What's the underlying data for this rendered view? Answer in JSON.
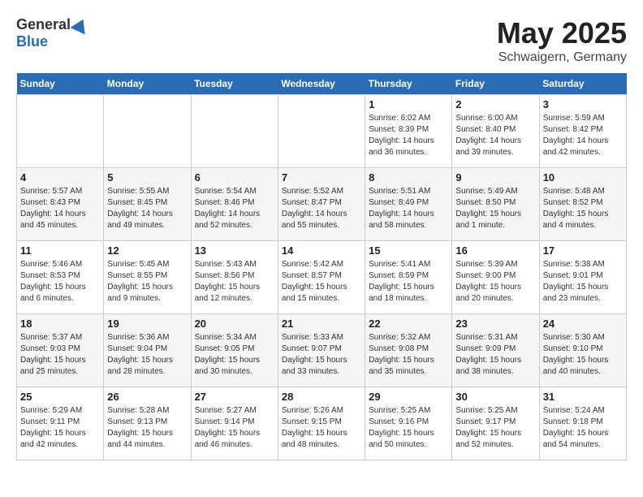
{
  "header": {
    "logo_general": "General",
    "logo_blue": "Blue",
    "title": "May 2025",
    "location": "Schwaigern, Germany"
  },
  "weekdays": [
    "Sunday",
    "Monday",
    "Tuesday",
    "Wednesday",
    "Thursday",
    "Friday",
    "Saturday"
  ],
  "weeks": [
    [
      {
        "day": "",
        "info": ""
      },
      {
        "day": "",
        "info": ""
      },
      {
        "day": "",
        "info": ""
      },
      {
        "day": "",
        "info": ""
      },
      {
        "day": "1",
        "info": "Sunrise: 6:02 AM\nSunset: 8:39 PM\nDaylight: 14 hours\nand 36 minutes."
      },
      {
        "day": "2",
        "info": "Sunrise: 6:00 AM\nSunset: 8:40 PM\nDaylight: 14 hours\nand 39 minutes."
      },
      {
        "day": "3",
        "info": "Sunrise: 5:59 AM\nSunset: 8:42 PM\nDaylight: 14 hours\nand 42 minutes."
      }
    ],
    [
      {
        "day": "4",
        "info": "Sunrise: 5:57 AM\nSunset: 8:43 PM\nDaylight: 14 hours\nand 45 minutes."
      },
      {
        "day": "5",
        "info": "Sunrise: 5:55 AM\nSunset: 8:45 PM\nDaylight: 14 hours\nand 49 minutes."
      },
      {
        "day": "6",
        "info": "Sunrise: 5:54 AM\nSunset: 8:46 PM\nDaylight: 14 hours\nand 52 minutes."
      },
      {
        "day": "7",
        "info": "Sunrise: 5:52 AM\nSunset: 8:47 PM\nDaylight: 14 hours\nand 55 minutes."
      },
      {
        "day": "8",
        "info": "Sunrise: 5:51 AM\nSunset: 8:49 PM\nDaylight: 14 hours\nand 58 minutes."
      },
      {
        "day": "9",
        "info": "Sunrise: 5:49 AM\nSunset: 8:50 PM\nDaylight: 15 hours\nand 1 minute."
      },
      {
        "day": "10",
        "info": "Sunrise: 5:48 AM\nSunset: 8:52 PM\nDaylight: 15 hours\nand 4 minutes."
      }
    ],
    [
      {
        "day": "11",
        "info": "Sunrise: 5:46 AM\nSunset: 8:53 PM\nDaylight: 15 hours\nand 6 minutes."
      },
      {
        "day": "12",
        "info": "Sunrise: 5:45 AM\nSunset: 8:55 PM\nDaylight: 15 hours\nand 9 minutes."
      },
      {
        "day": "13",
        "info": "Sunrise: 5:43 AM\nSunset: 8:56 PM\nDaylight: 15 hours\nand 12 minutes."
      },
      {
        "day": "14",
        "info": "Sunrise: 5:42 AM\nSunset: 8:57 PM\nDaylight: 15 hours\nand 15 minutes."
      },
      {
        "day": "15",
        "info": "Sunrise: 5:41 AM\nSunset: 8:59 PM\nDaylight: 15 hours\nand 18 minutes."
      },
      {
        "day": "16",
        "info": "Sunrise: 5:39 AM\nSunset: 9:00 PM\nDaylight: 15 hours\nand 20 minutes."
      },
      {
        "day": "17",
        "info": "Sunrise: 5:38 AM\nSunset: 9:01 PM\nDaylight: 15 hours\nand 23 minutes."
      }
    ],
    [
      {
        "day": "18",
        "info": "Sunrise: 5:37 AM\nSunset: 9:03 PM\nDaylight: 15 hours\nand 25 minutes."
      },
      {
        "day": "19",
        "info": "Sunrise: 5:36 AM\nSunset: 9:04 PM\nDaylight: 15 hours\nand 28 minutes."
      },
      {
        "day": "20",
        "info": "Sunrise: 5:34 AM\nSunset: 9:05 PM\nDaylight: 15 hours\nand 30 minutes."
      },
      {
        "day": "21",
        "info": "Sunrise: 5:33 AM\nSunset: 9:07 PM\nDaylight: 15 hours\nand 33 minutes."
      },
      {
        "day": "22",
        "info": "Sunrise: 5:32 AM\nSunset: 9:08 PM\nDaylight: 15 hours\nand 35 minutes."
      },
      {
        "day": "23",
        "info": "Sunrise: 5:31 AM\nSunset: 9:09 PM\nDaylight: 15 hours\nand 38 minutes."
      },
      {
        "day": "24",
        "info": "Sunrise: 5:30 AM\nSunset: 9:10 PM\nDaylight: 15 hours\nand 40 minutes."
      }
    ],
    [
      {
        "day": "25",
        "info": "Sunrise: 5:29 AM\nSunset: 9:11 PM\nDaylight: 15 hours\nand 42 minutes."
      },
      {
        "day": "26",
        "info": "Sunrise: 5:28 AM\nSunset: 9:13 PM\nDaylight: 15 hours\nand 44 minutes."
      },
      {
        "day": "27",
        "info": "Sunrise: 5:27 AM\nSunset: 9:14 PM\nDaylight: 15 hours\nand 46 minutes."
      },
      {
        "day": "28",
        "info": "Sunrise: 5:26 AM\nSunset: 9:15 PM\nDaylight: 15 hours\nand 48 minutes."
      },
      {
        "day": "29",
        "info": "Sunrise: 5:25 AM\nSunset: 9:16 PM\nDaylight: 15 hours\nand 50 minutes."
      },
      {
        "day": "30",
        "info": "Sunrise: 5:25 AM\nSunset: 9:17 PM\nDaylight: 15 hours\nand 52 minutes."
      },
      {
        "day": "31",
        "info": "Sunrise: 5:24 AM\nSunset: 9:18 PM\nDaylight: 15 hours\nand 54 minutes."
      }
    ]
  ]
}
